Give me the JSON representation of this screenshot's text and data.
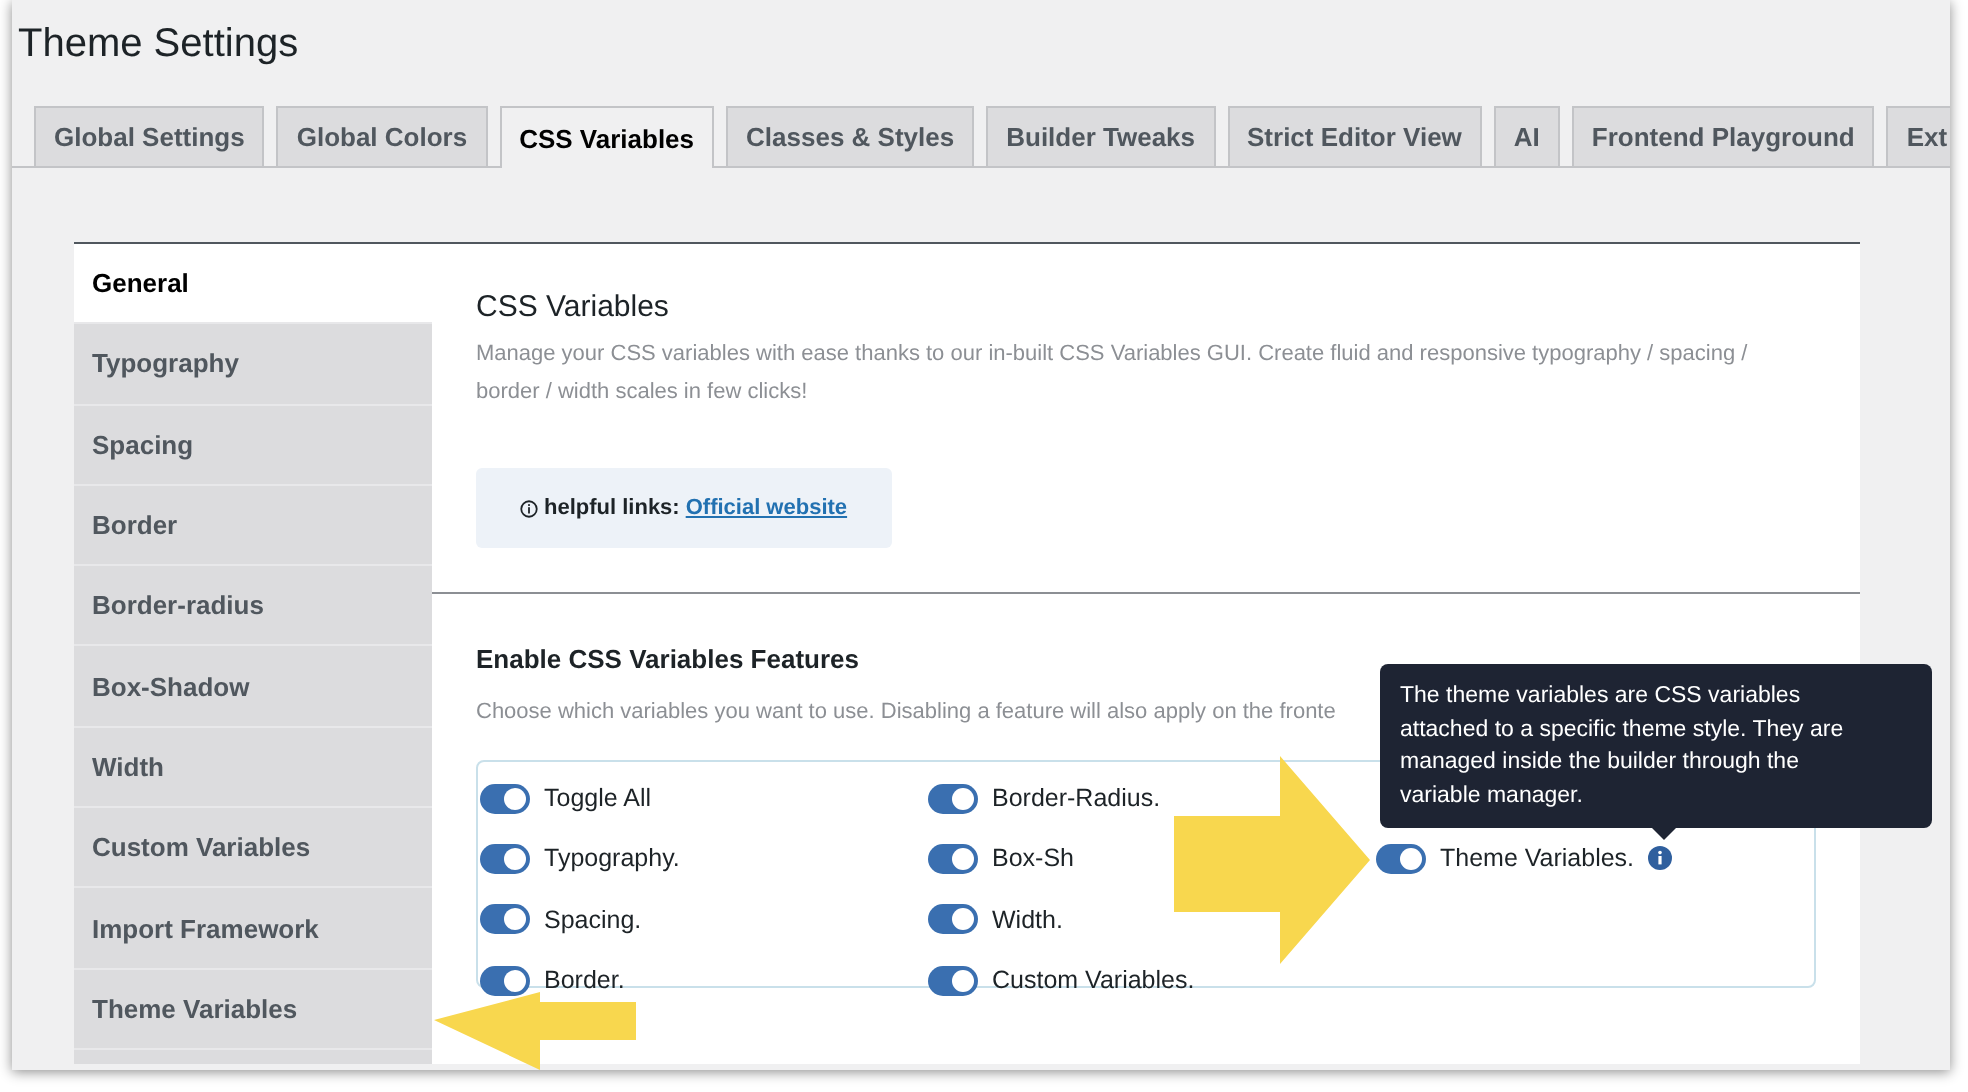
{
  "page": {
    "title": "Theme Settings"
  },
  "tabs": [
    {
      "label": "Global Settings",
      "selected": false
    },
    {
      "label": "Global Colors",
      "selected": false
    },
    {
      "label": "CSS Variables",
      "selected": true
    },
    {
      "label": "Classes & Styles",
      "selected": false
    },
    {
      "label": "Builder Tweaks",
      "selected": false
    },
    {
      "label": "Strict Editor View",
      "selected": false
    },
    {
      "label": "AI",
      "selected": false
    },
    {
      "label": "Frontend Playground",
      "selected": false
    },
    {
      "label": "Ext",
      "selected": false
    }
  ],
  "sidebar": {
    "items": [
      {
        "label": "General",
        "selected": true
      },
      {
        "label": "Typography",
        "selected": false
      },
      {
        "label": "Spacing",
        "selected": false
      },
      {
        "label": "Border",
        "selected": false
      },
      {
        "label": "Border-radius",
        "selected": false
      },
      {
        "label": "Box-Shadow",
        "selected": false
      },
      {
        "label": "Width",
        "selected": false
      },
      {
        "label": "Custom Variables",
        "selected": false
      },
      {
        "label": "Import Framework",
        "selected": false
      },
      {
        "label": "Theme Variables",
        "selected": false
      }
    ]
  },
  "intro": {
    "title": "CSS Variables",
    "description": "Manage your CSS variables with ease thanks to our in-built CSS Variables GUI. Create fluid and responsive typography / spacing / border / width scales in few clicks!",
    "links_label": "helpful links:",
    "link": "Official website"
  },
  "features": {
    "title": "Enable CSS Variables Features",
    "description": "Choose which variables you want to use. Disabling a feature will also apply on the fronte",
    "columns": [
      [
        {
          "label": "Toggle All",
          "on": true
        },
        {
          "label": "Typography.",
          "on": true
        },
        {
          "label": "Spacing.",
          "on": true
        },
        {
          "label": "Border.",
          "on": true
        }
      ],
      [
        {
          "label": "Border-Radius.",
          "on": true
        },
        {
          "label": "Box-Sh",
          "on": true
        },
        {
          "label": "Width.",
          "on": true
        },
        {
          "label": "Custom Variables.",
          "on": true
        }
      ],
      [
        {
          "label": "Theme Variables.",
          "on": true,
          "info": true
        }
      ]
    ]
  },
  "tooltip": {
    "text": "The theme variables are CSS variables attached to a specific theme style. They are managed inside the builder through the variable manager."
  }
}
